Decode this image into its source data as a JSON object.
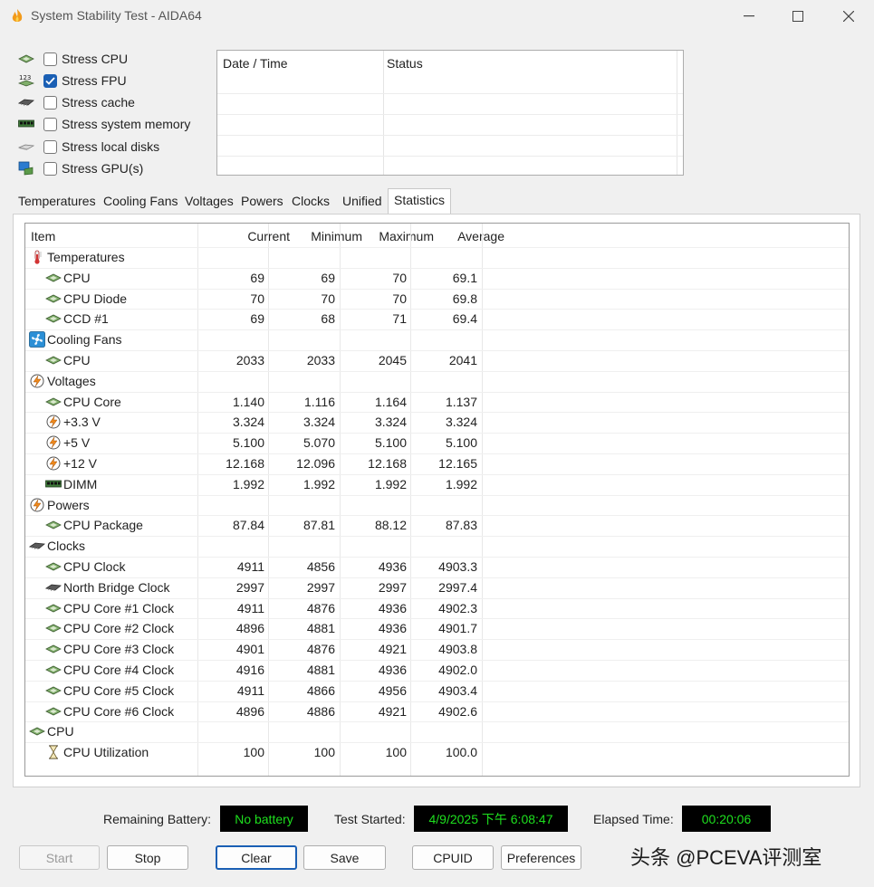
{
  "window": {
    "title": "System Stability Test - AIDA64"
  },
  "stress": [
    {
      "label": "Stress CPU",
      "checked": false,
      "icon": "cpu-chip-icon"
    },
    {
      "label": "Stress FPU",
      "checked": true,
      "icon": "fpu-123-icon"
    },
    {
      "label": "Stress cache",
      "checked": false,
      "icon": "cache-chip-icon"
    },
    {
      "label": "Stress system memory",
      "checked": false,
      "icon": "memory-module-icon"
    },
    {
      "label": "Stress local disks",
      "checked": false,
      "icon": "disk-drive-icon"
    },
    {
      "label": "Stress GPU(s)",
      "checked": false,
      "icon": "gpu-monitor-icon"
    }
  ],
  "status_table": {
    "col1": "Date / Time",
    "col2": "Status"
  },
  "tabs": [
    "Temperatures",
    "Cooling Fans",
    "Voltages",
    "Powers",
    "Clocks",
    "Unified",
    "Statistics"
  ],
  "active_tab": "Statistics",
  "stats": {
    "headers": {
      "item": "Item",
      "current": "Current",
      "minimum": "Minimum",
      "maximum": "Maximum",
      "average": "Average"
    },
    "rows": [
      {
        "name": "Temperatures",
        "group": true,
        "icon": "thermometer-icon"
      },
      {
        "name": "CPU",
        "icon": "cpu-chip-icon",
        "current": "69",
        "minimum": "69",
        "maximum": "70",
        "average": "69.1"
      },
      {
        "name": "CPU Diode",
        "icon": "cpu-chip-icon",
        "current": "70",
        "minimum": "70",
        "maximum": "70",
        "average": "69.8"
      },
      {
        "name": "CCD #1",
        "icon": "cpu-chip-icon",
        "current": "69",
        "minimum": "68",
        "maximum": "71",
        "average": "69.4"
      },
      {
        "name": "Cooling Fans",
        "group": true,
        "icon": "fan-icon"
      },
      {
        "name": "CPU",
        "icon": "cpu-chip-icon",
        "current": "2033",
        "minimum": "2033",
        "maximum": "2045",
        "average": "2041"
      },
      {
        "name": "Voltages",
        "group": true,
        "icon": "lightning-icon"
      },
      {
        "name": "CPU Core",
        "icon": "cpu-chip-icon",
        "current": "1.140",
        "minimum": "1.116",
        "maximum": "1.164",
        "average": "1.137"
      },
      {
        "name": "+3.3 V",
        "icon": "lightning-icon",
        "current": "3.324",
        "minimum": "3.324",
        "maximum": "3.324",
        "average": "3.324"
      },
      {
        "name": "+5 V",
        "icon": "lightning-icon",
        "current": "5.100",
        "minimum": "5.070",
        "maximum": "5.100",
        "average": "5.100"
      },
      {
        "name": "+12 V",
        "icon": "lightning-icon",
        "current": "12.168",
        "minimum": "12.096",
        "maximum": "12.168",
        "average": "12.165"
      },
      {
        "name": "DIMM",
        "icon": "memory-module-icon",
        "current": "1.992",
        "minimum": "1.992",
        "maximum": "1.992",
        "average": "1.992"
      },
      {
        "name": "Powers",
        "group": true,
        "icon": "lightning-icon"
      },
      {
        "name": "CPU Package",
        "icon": "cpu-chip-icon",
        "current": "87.84",
        "minimum": "87.81",
        "maximum": "88.12",
        "average": "87.83"
      },
      {
        "name": "Clocks",
        "group": true,
        "icon": "cache-chip-icon"
      },
      {
        "name": "CPU Clock",
        "icon": "cpu-chip-icon",
        "current": "4911",
        "minimum": "4856",
        "maximum": "4936",
        "average": "4903.3"
      },
      {
        "name": "North Bridge Clock",
        "icon": "cache-chip-icon",
        "current": "2997",
        "minimum": "2997",
        "maximum": "2997",
        "average": "2997.4"
      },
      {
        "name": "CPU Core #1 Clock",
        "icon": "cpu-chip-icon",
        "current": "4911",
        "minimum": "4876",
        "maximum": "4936",
        "average": "4902.3"
      },
      {
        "name": "CPU Core #2 Clock",
        "icon": "cpu-chip-icon",
        "current": "4896",
        "minimum": "4881",
        "maximum": "4936",
        "average": "4901.7"
      },
      {
        "name": "CPU Core #3 Clock",
        "icon": "cpu-chip-icon",
        "current": "4901",
        "minimum": "4876",
        "maximum": "4921",
        "average": "4903.8"
      },
      {
        "name": "CPU Core #4 Clock",
        "icon": "cpu-chip-icon",
        "current": "4916",
        "minimum": "4881",
        "maximum": "4936",
        "average": "4902.0"
      },
      {
        "name": "CPU Core #5 Clock",
        "icon": "cpu-chip-icon",
        "current": "4911",
        "minimum": "4866",
        "maximum": "4956",
        "average": "4903.4"
      },
      {
        "name": "CPU Core #6 Clock",
        "icon": "cpu-chip-icon",
        "current": "4896",
        "minimum": "4886",
        "maximum": "4921",
        "average": "4902.6"
      },
      {
        "name": "CPU",
        "group": true,
        "icon": "cpu-chip-icon"
      },
      {
        "name": "CPU Utilization",
        "icon": "hourglass-icon",
        "current": "100",
        "minimum": "100",
        "maximum": "100",
        "average": "100.0"
      }
    ]
  },
  "footer": {
    "battery_label": "Remaining Battery:",
    "battery_value": "No battery",
    "started_label": "Test Started:",
    "started_value": "4/9/2025 下午 6:08:47",
    "elapsed_label": "Elapsed Time:",
    "elapsed_value": "00:20:06"
  },
  "buttons": {
    "start": "Start",
    "stop": "Stop",
    "clear": "Clear",
    "save": "Save",
    "cpuid": "CPUID",
    "preferences": "Preferences"
  },
  "watermark": "头条 @PCEVA评测室",
  "colors": {
    "lcd_bg": "#000000",
    "lcd_text": "#1ee01e",
    "checkbox_checked": "#1a5fb4"
  }
}
